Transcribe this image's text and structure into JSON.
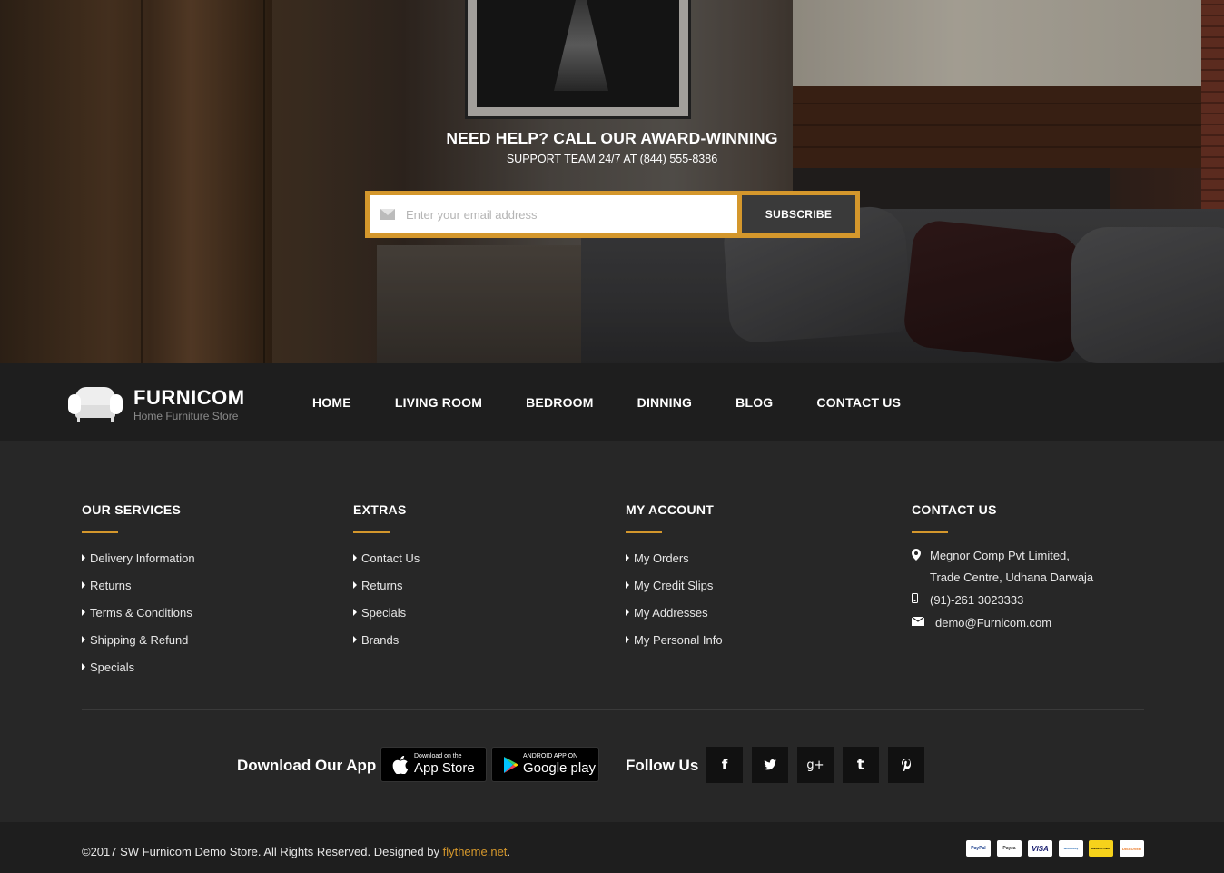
{
  "hero": {
    "title": "NEED HELP? CALL OUR AWARD-WINNING",
    "subtitle": "SUPPORT TEAM 24/7 AT (844) 555-8386",
    "email_placeholder": "Enter your email address",
    "subscribe_label": "SUBSCRIBE"
  },
  "logo": {
    "brand": "FURNICOM",
    "tagline": "Home Furniture Store"
  },
  "nav": [
    "HOME",
    "LIVING ROOM",
    "BEDROOM",
    "DINNING",
    "BLOG",
    "CONTACT US"
  ],
  "footer": {
    "services": {
      "title": "OUR SERVICES",
      "items": [
        "Delivery Information",
        "Returns",
        "Terms & Conditions",
        "Shipping & Refund",
        "Specials"
      ]
    },
    "extras": {
      "title": "EXTRAS",
      "items": [
        "Contact Us",
        "Returns",
        "Specials",
        "Brands"
      ]
    },
    "account": {
      "title": "MY ACCOUNT",
      "items": [
        "My Orders",
        "My Credit Slips",
        "My Addresses",
        "My Personal Info"
      ]
    },
    "contact": {
      "title": "CONTACT US",
      "address1": "Megnor Comp Pvt Limited,",
      "address2": "Trade Centre, Udhana Darwaja",
      "phone": "(91)-261 3023333",
      "email": "demo@Furnicom.com"
    }
  },
  "apps": {
    "label": "Download Our App",
    "appstore_small": "Download on the",
    "appstore_big": "App Store",
    "gplay_small": "ANDROID APP ON",
    "gplay_big": "Google play"
  },
  "follow": {
    "label": "Follow Us",
    "icons": [
      "facebook-icon",
      "twitter-icon",
      "google-plus-icon",
      "tumblr-icon",
      "pinterest-icon"
    ],
    "glyphs": [
      "f",
      "🐦",
      "g+",
      "t",
      "℗"
    ]
  },
  "bottom": {
    "copyright": "©2017 SW Furnicom Demo Store. All Rights Reserved. Designed by ",
    "link": "flytheme.net",
    "period": ".",
    "payments": [
      "PayPal",
      "Payza",
      "VISA",
      "Webmoney",
      "Western Union",
      "DISCOVER"
    ]
  },
  "colors": {
    "accent": "#d4972c",
    "footer_bg": "#272727",
    "bar_bg": "#1e1e1e"
  }
}
